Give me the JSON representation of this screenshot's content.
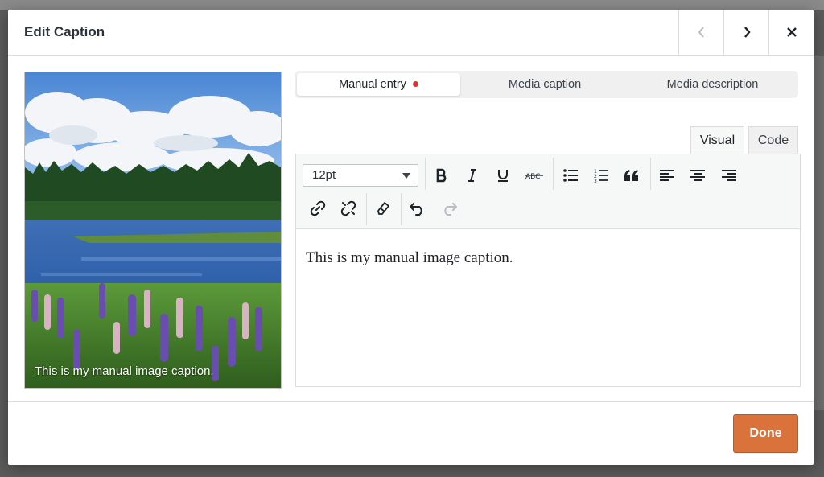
{
  "modal": {
    "title": "Edit Caption",
    "prev_icon": "chevron-left-icon",
    "next_icon": "chevron-right-icon",
    "close_icon": "close-icon"
  },
  "preview": {
    "caption": "This is my manual image caption.",
    "image": "landscape-lake-lupins"
  },
  "source_tabs": [
    {
      "label": "Manual entry",
      "active": true,
      "has_indicator": true
    },
    {
      "label": "Media caption",
      "active": false
    },
    {
      "label": "Media description",
      "active": false
    }
  ],
  "editor_tabs": {
    "visual": "Visual",
    "code": "Code",
    "active": "visual"
  },
  "toolbar": {
    "font_size": "12pt",
    "buttons": [
      "bold",
      "italic",
      "underline",
      "strikethrough",
      "bulleted-list",
      "numbered-list",
      "blockquote",
      "align-left",
      "align-center",
      "align-right",
      "link",
      "unlink",
      "clear-formatting",
      "undo",
      "redo"
    ]
  },
  "editor_content": "This is my manual image caption.",
  "footer": {
    "done_label": "Done"
  },
  "colors": {
    "accent": "#d9733b",
    "indicator": "#d63638"
  }
}
